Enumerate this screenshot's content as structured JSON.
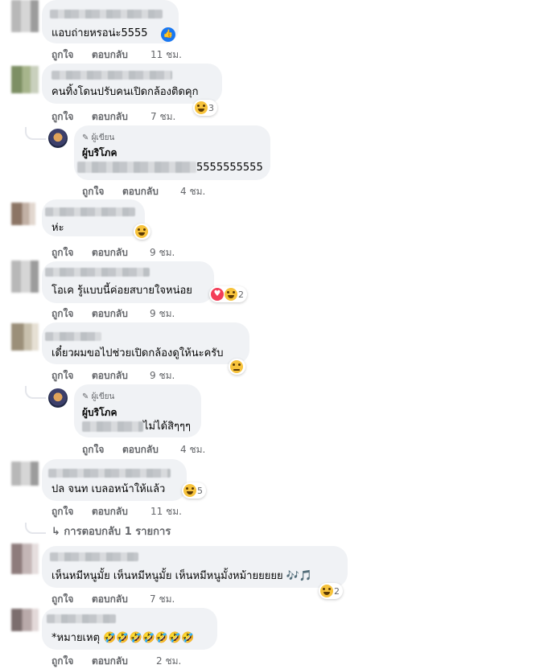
{
  "actions": {
    "like": "ถูกใจ",
    "reply": "ตอบกลับ"
  },
  "author_badge": "ผู้เขียน",
  "page_name": "ผู้บริโภค",
  "comments": [
    {
      "text": "แอบถ่ายหรอน่ะ5555",
      "time": "11 ชม.",
      "reaction_count": ""
    },
    {
      "text": "คนทิ้งโดนปรับคนเปิดกล้องติดคุก",
      "time": "7 ชม.",
      "reaction_count": "3"
    },
    {
      "text": "ห่ะ",
      "time": "9 ชม.",
      "reaction_count": ""
    },
    {
      "text": "โอเค รู้แบบนี้ค่อยสบายใจหน่อย",
      "time": "9 ชม.",
      "reaction_count": "2"
    },
    {
      "text": "เดี๋ยวผมขอไปช่วยเปิดกล้องดูให้นะครับ",
      "time": "9 ชม.",
      "reaction_count": ""
    },
    {
      "text": "ปล จนท เบลอหน้าให้แล้ว",
      "time": "11 ชม.",
      "reaction_count": "5"
    },
    {
      "text": "เห็นหมีหนูมั้ย เห็นหมีหนูมั้ย เห็นหมีหนูมั้งหม้ายยยยย 🎶🎵",
      "time": "7 ชม.",
      "reaction_count": "2"
    },
    {
      "text": "*หมายเหตุ 🤣🤣🤣🤣🤣🤣🤣",
      "time": "2 ชม."
    }
  ],
  "replies": [
    {
      "text": "5555555555",
      "time": "4 ชม."
    },
    {
      "text": "ไม่ได้สิๆๆๆ",
      "time": "4 ชม."
    }
  ],
  "more_replies": "↳ การตอบกลับ 1 รายการ"
}
